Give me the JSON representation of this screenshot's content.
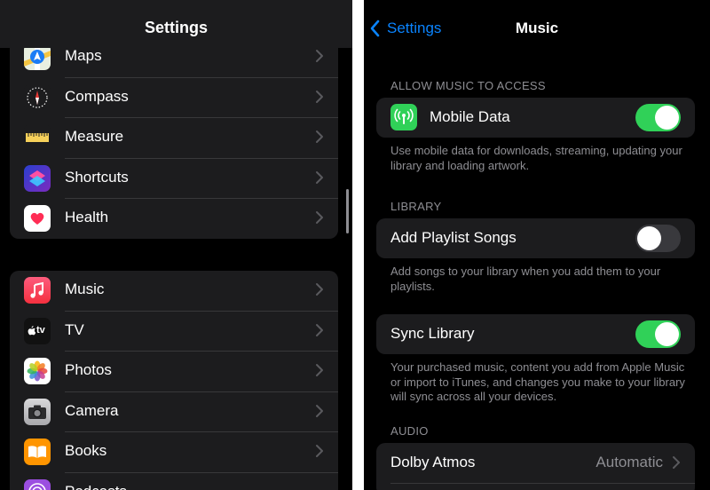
{
  "left": {
    "title": "Settings",
    "group1": [
      {
        "label": "Maps",
        "icon": "maps-icon"
      },
      {
        "label": "Compass",
        "icon": "compass-icon"
      },
      {
        "label": "Measure",
        "icon": "measure-icon"
      },
      {
        "label": "Shortcuts",
        "icon": "shortcuts-icon"
      },
      {
        "label": "Health",
        "icon": "health-icon"
      }
    ],
    "group2": [
      {
        "label": "Music",
        "icon": "music-icon"
      },
      {
        "label": "TV",
        "icon": "tv-icon"
      },
      {
        "label": "Photos",
        "icon": "photos-icon"
      },
      {
        "label": "Camera",
        "icon": "camera-icon"
      },
      {
        "label": "Books",
        "icon": "books-icon"
      },
      {
        "label": "Podcasts",
        "icon": "podcasts-icon"
      }
    ],
    "tv_icon_text": "tv"
  },
  "right": {
    "back_label": "Settings",
    "title": "Music",
    "section_access": "ALLOW MUSIC TO ACCESS",
    "mobile_data_label": "Mobile Data",
    "mobile_data_on": true,
    "mobile_data_footer": "Use mobile data for downloads, streaming, updating your library and loading artwork.",
    "section_library": "LIBRARY",
    "add_playlist_label": "Add Playlist Songs",
    "add_playlist_on": false,
    "add_playlist_footer": "Add songs to your library when you add them to your playlists.",
    "sync_library_label": "Sync Library",
    "sync_library_on": true,
    "sync_library_footer": "Your purchased music, content you add from Apple Music or import to iTunes, and changes you make to your library will sync across all your devices.",
    "section_audio": "AUDIO",
    "dolby_label": "Dolby Atmos",
    "dolby_value": "Automatic"
  },
  "colors": {
    "accent_blue": "#0a84ff",
    "toggle_green": "#30d158",
    "background": "#000000",
    "cell_background": "#1c1c1e",
    "secondary_text": "#8e8e93"
  }
}
